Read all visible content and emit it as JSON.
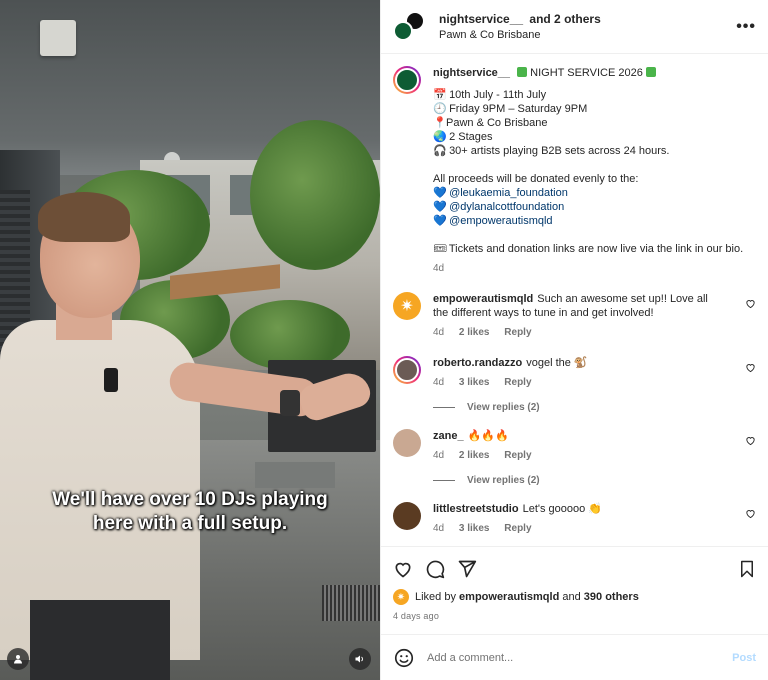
{
  "video": {
    "caption_line1": "We'll have over 10 DJs playing",
    "caption_line2": "here with a full setup.",
    "icons": {
      "user": "user-icon",
      "sound": "speaker-icon"
    }
  },
  "header": {
    "username": "nightservice__",
    "and_others": "and 2 others",
    "location": "Pawn & Co Brisbane",
    "more_icon": "more-horizontal-icon"
  },
  "post": {
    "username": "nightservice__",
    "title": "NIGHT SERVICE 2026",
    "lines": [
      {
        "emoji": "calendar-icon",
        "text": "10th July - 11th July"
      },
      {
        "emoji": "clock-icon",
        "text": "Friday 9PM – Saturday 9PM"
      },
      {
        "emoji": "pin-icon",
        "text": "Pawn & Co Brisbane"
      },
      {
        "emoji": "globe-icon",
        "text": "2 Stages"
      },
      {
        "emoji": "headphones-icon",
        "text": "30+ artists playing B2B sets across 24 hours."
      }
    ],
    "proceeds": "All proceeds will be donated evenly to the:",
    "mentions": [
      "@leukaemia_foundation",
      "@dylanalcottfoundation",
      "@empowerautismqld"
    ],
    "tickets": "Tickets and donation links are now live via the link in our bio.",
    "age": "4d"
  },
  "comments": [
    {
      "user": "empowerautismqld",
      "text": "Such an awesome set up!! Love all the different ways to tune in and get involved!",
      "age": "4d",
      "likes": "2 likes",
      "reply": "Reply",
      "avatar_color": "#f6a623",
      "view_replies": ""
    },
    {
      "user": "roberto.randazzo",
      "text": "vogel the 🐒",
      "age": "4d",
      "likes": "3 likes",
      "reply": "Reply",
      "avatar_color": "#6b5b55",
      "view_replies": "View replies (2)"
    },
    {
      "user": "zane_",
      "text": "🔥🔥🔥",
      "age": "4d",
      "likes": "2 likes",
      "reply": "Reply",
      "avatar_color": "#c9a892",
      "view_replies": "View replies (2)"
    },
    {
      "user": "littlestreetstudio",
      "text": "Let's gooooo 👏",
      "age": "4d",
      "likes": "3 likes",
      "reply": "Reply",
      "avatar_color": "#5a3b22",
      "view_replies": ""
    }
  ],
  "actions": {
    "liked_by_prefix": "Liked by",
    "liked_by_user": "empowerautismqld",
    "and": "and",
    "others": "390 others",
    "date": "4 days ago"
  },
  "composer": {
    "placeholder": "Add a comment...",
    "post_label": "Post"
  },
  "colors": {
    "link": "#00376b",
    "muted": "#737373",
    "post_btn": "#b3dbff"
  }
}
